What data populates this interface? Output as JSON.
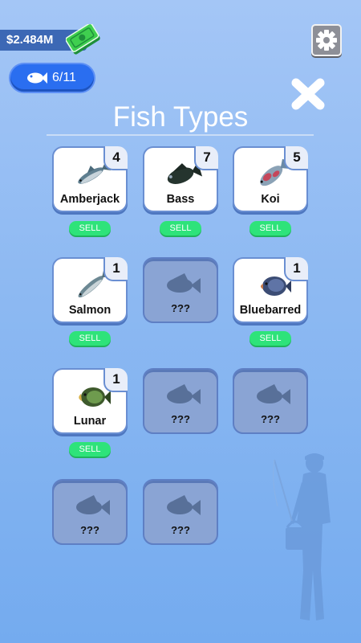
{
  "header": {
    "money": "$2.484M",
    "fish_count": "6/11"
  },
  "title": "Fish Types",
  "fish": [
    {
      "name": "Amberjack",
      "count": "4",
      "sell_label": "SELL",
      "color": "#5a7a8c"
    },
    {
      "name": "Bass",
      "count": "7",
      "sell_label": "SELL",
      "color": "#2a3a33"
    },
    {
      "name": "Koi",
      "count": "5",
      "sell_label": "SELL",
      "color": "#c85a6a"
    },
    {
      "name": "Salmon",
      "count": "1",
      "sell_label": "SELL",
      "color": "#6b8590"
    },
    {
      "name": "???"
    },
    {
      "name": "Bluebarred",
      "count": "1",
      "sell_label": "SELL",
      "color": "#3e4f7a"
    },
    {
      "name": "Lunar",
      "count": "1",
      "sell_label": "SELL",
      "color": "#4c7a3a"
    },
    {
      "name": "???"
    },
    {
      "name": "???"
    },
    {
      "name": "???"
    },
    {
      "name": "???"
    }
  ],
  "colors": {
    "sell_button": "#2ee37a",
    "pill": "#2a6ef0",
    "money_bar": "#3c68b5"
  }
}
